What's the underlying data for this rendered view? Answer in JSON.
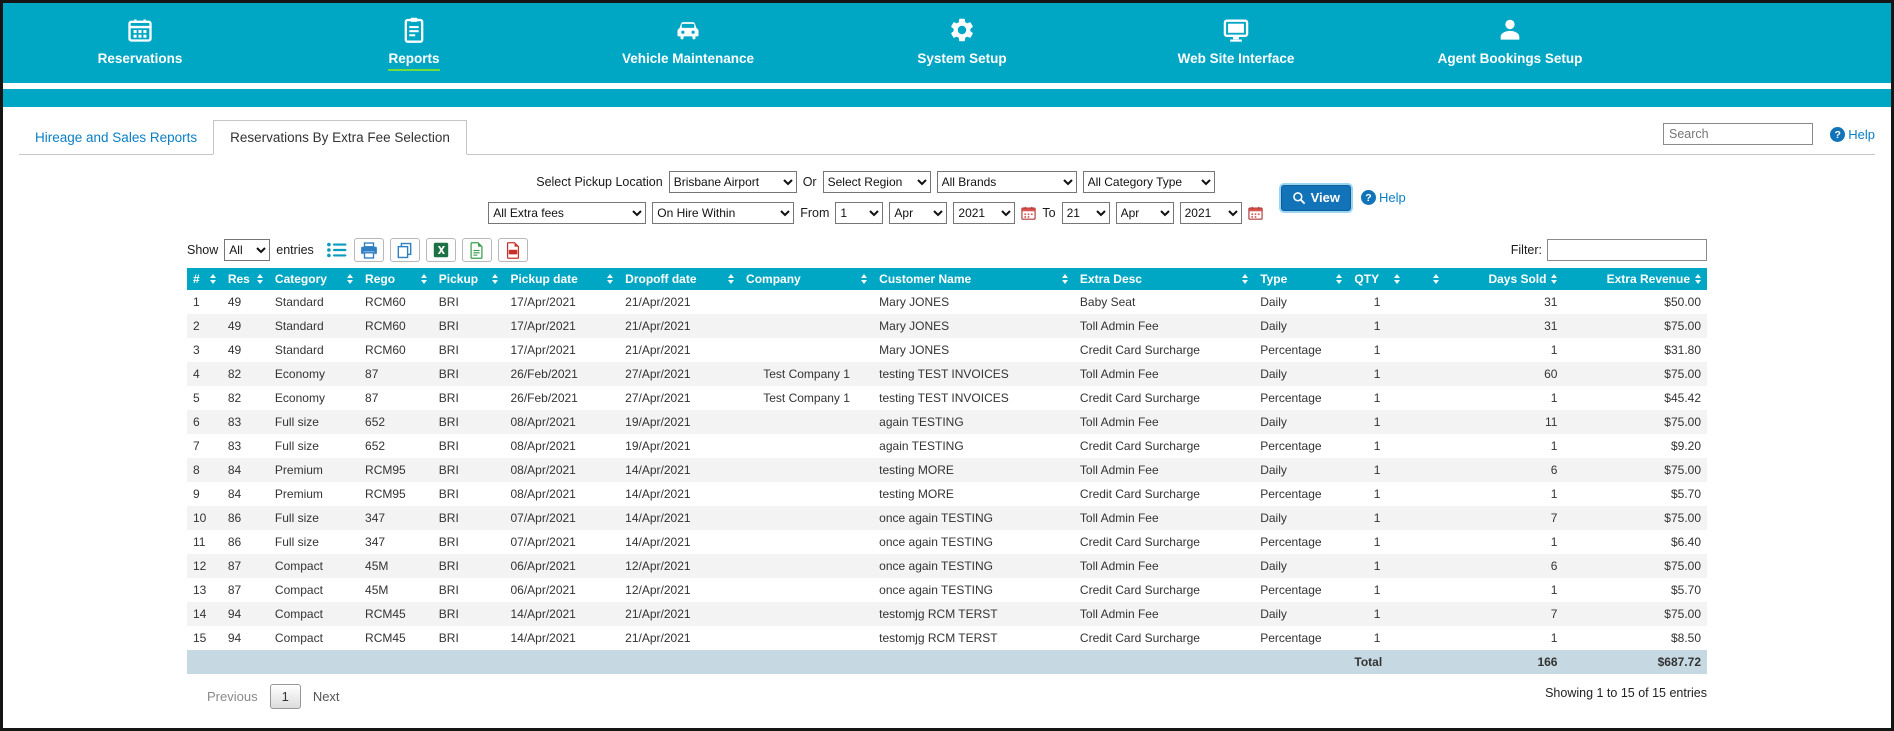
{
  "colors": {
    "teal": "#00a7c4",
    "link_blue": "#0b7fc4",
    "res_red": "#e23b3b",
    "button_blue": "#1273b8",
    "total_row_bg": "#c6d9e2",
    "active_underline_green": "#6fdc3c"
  },
  "icons": {
    "help_glyph": "?"
  },
  "nav": {
    "items": [
      {
        "label": "Reservations"
      },
      {
        "label": "Reports"
      },
      {
        "label": "Vehicle Maintenance"
      },
      {
        "label": "System Setup"
      },
      {
        "label": "Web Site Interface"
      },
      {
        "label": "Agent Bookings Setup"
      }
    ]
  },
  "tabs": {
    "hireage": "Hireage and Sales Reports",
    "active": "Reservations By Extra Fee Selection",
    "search_placeholder": "Search",
    "help": "Help"
  },
  "filters": {
    "pickup_location_label": "Select Pickup Location",
    "pickup_location": "Brisbane Airport",
    "or_label": "Or",
    "region": "Select Region",
    "brands": "All Brands",
    "category_type": "All Category Type",
    "view_button": "View",
    "help": "Help",
    "extra_fees": "All Extra fees",
    "hire_within": "On Hire Within",
    "from_label": "From",
    "from_day": "1",
    "from_month": "Apr",
    "from_year": "2021",
    "to_label": "To",
    "to_day": "21",
    "to_month": "Apr",
    "to_year": "2021"
  },
  "toolbar": {
    "show_label": "Show",
    "show_value": "All",
    "entries_label": "entries",
    "filter_label": "Filter:"
  },
  "table": {
    "columns": [
      "#",
      "Res",
      "Category",
      "Rego",
      "Pickup",
      "Pickup date",
      "Dropoff date",
      "Company",
      "Customer Name",
      "Extra Desc",
      "Type",
      "QTY",
      "",
      "Days Sold",
      "Extra Revenue"
    ],
    "rows": [
      [
        "1",
        "49",
        "Standard",
        "RCM60",
        "BRI",
        "17/Apr/2021",
        "21/Apr/2021",
        "",
        "Mary JONES",
        "Baby Seat",
        "Daily",
        "1",
        "",
        "31",
        "$50.00"
      ],
      [
        "2",
        "49",
        "Standard",
        "RCM60",
        "BRI",
        "17/Apr/2021",
        "21/Apr/2021",
        "",
        "Mary JONES",
        "Toll Admin Fee",
        "Daily",
        "1",
        "",
        "31",
        "$75.00"
      ],
      [
        "3",
        "49",
        "Standard",
        "RCM60",
        "BRI",
        "17/Apr/2021",
        "21/Apr/2021",
        "",
        "Mary JONES",
        "Credit Card Surcharge",
        "Percentage",
        "1",
        "",
        "1",
        "$31.80"
      ],
      [
        "4",
        "82",
        "Economy",
        "87",
        "BRI",
        "26/Feb/2021",
        "27/Apr/2021",
        "Test Company 1",
        "testing TEST INVOICES",
        "Toll Admin Fee",
        "Daily",
        "1",
        "",
        "60",
        "$75.00"
      ],
      [
        "5",
        "82",
        "Economy",
        "87",
        "BRI",
        "26/Feb/2021",
        "27/Apr/2021",
        "Test Company 1",
        "testing TEST INVOICES",
        "Credit Card Surcharge",
        "Percentage",
        "1",
        "",
        "1",
        "$45.42"
      ],
      [
        "6",
        "83",
        "Full size",
        "652",
        "BRI",
        "08/Apr/2021",
        "19/Apr/2021",
        "",
        "again TESTING",
        "Toll Admin Fee",
        "Daily",
        "1",
        "",
        "11",
        "$75.00"
      ],
      [
        "7",
        "83",
        "Full size",
        "652",
        "BRI",
        "08/Apr/2021",
        "19/Apr/2021",
        "",
        "again TESTING",
        "Credit Card Surcharge",
        "Percentage",
        "1",
        "",
        "1",
        "$9.20"
      ],
      [
        "8",
        "84",
        "Premium",
        "RCM95",
        "BRI",
        "08/Apr/2021",
        "14/Apr/2021",
        "",
        "testing MORE",
        "Toll Admin Fee",
        "Daily",
        "1",
        "",
        "6",
        "$75.00"
      ],
      [
        "9",
        "84",
        "Premium",
        "RCM95",
        "BRI",
        "08/Apr/2021",
        "14/Apr/2021",
        "",
        "testing MORE",
        "Credit Card Surcharge",
        "Percentage",
        "1",
        "",
        "1",
        "$5.70"
      ],
      [
        "10",
        "86",
        "Full size",
        "347",
        "BRI",
        "07/Apr/2021",
        "14/Apr/2021",
        "",
        "once again TESTING",
        "Toll Admin Fee",
        "Daily",
        "1",
        "",
        "7",
        "$75.00"
      ],
      [
        "11",
        "86",
        "Full size",
        "347",
        "BRI",
        "07/Apr/2021",
        "14/Apr/2021",
        "",
        "once again TESTING",
        "Credit Card Surcharge",
        "Percentage",
        "1",
        "",
        "1",
        "$6.40"
      ],
      [
        "12",
        "87",
        "Compact",
        "45M",
        "BRI",
        "06/Apr/2021",
        "12/Apr/2021",
        "",
        "once again TESTING",
        "Toll Admin Fee",
        "Daily",
        "1",
        "",
        "6",
        "$75.00"
      ],
      [
        "13",
        "87",
        "Compact",
        "45M",
        "BRI",
        "06/Apr/2021",
        "12/Apr/2021",
        "",
        "once again TESTING",
        "Credit Card Surcharge",
        "Percentage",
        "1",
        "",
        "1",
        "$5.70"
      ],
      [
        "14",
        "94",
        "Compact",
        "RCM45",
        "BRI",
        "14/Apr/2021",
        "21/Apr/2021",
        "",
        "testomjg RCM TERST",
        "Toll Admin Fee",
        "Daily",
        "1",
        "",
        "7",
        "$75.00"
      ],
      [
        "15",
        "94",
        "Compact",
        "RCM45",
        "BRI",
        "14/Apr/2021",
        "21/Apr/2021",
        "",
        "testomjg RCM TERST",
        "Credit Card Surcharge",
        "Percentage",
        "1",
        "",
        "1",
        "$8.50"
      ]
    ],
    "footer": {
      "total_label": "Total",
      "total_days": "166",
      "total_revenue": "$687.72"
    }
  },
  "pagination": {
    "previous": "Previous",
    "page": "1",
    "next": "Next",
    "showing": "Showing 1 to 15 of 15 entries"
  }
}
